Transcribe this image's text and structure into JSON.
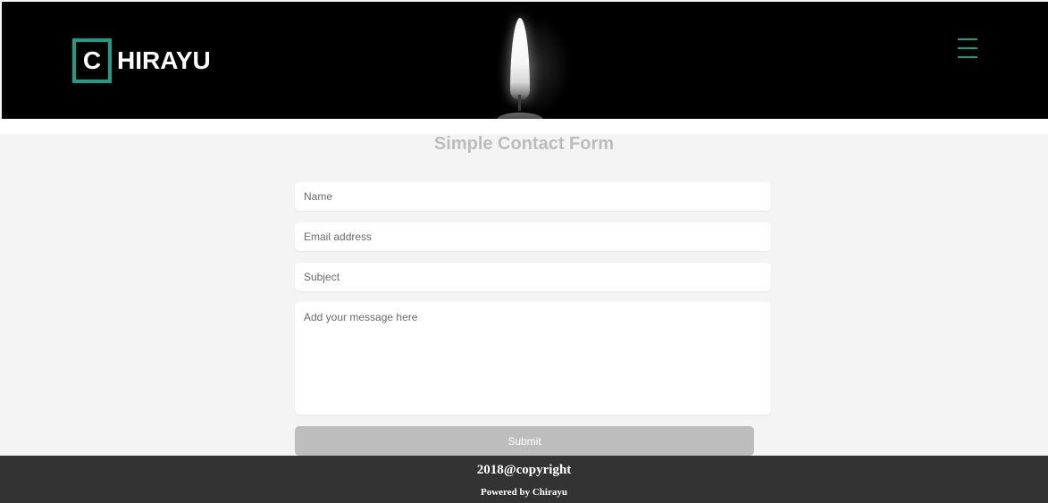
{
  "header": {
    "logo_letter": "C",
    "logo_text": "HIRAYU",
    "menu_icon": "hamburger-menu-icon",
    "accent_color": "#16a085"
  },
  "form": {
    "title": "Simple Contact Form",
    "name_placeholder": "Name",
    "email_placeholder": "Email address",
    "subject_placeholder": "Subject",
    "message_placeholder": "Add your message here",
    "submit_label": "Submit"
  },
  "footer": {
    "copyright": "2018@copyright",
    "powered_by": "Powered by Chirayu"
  }
}
